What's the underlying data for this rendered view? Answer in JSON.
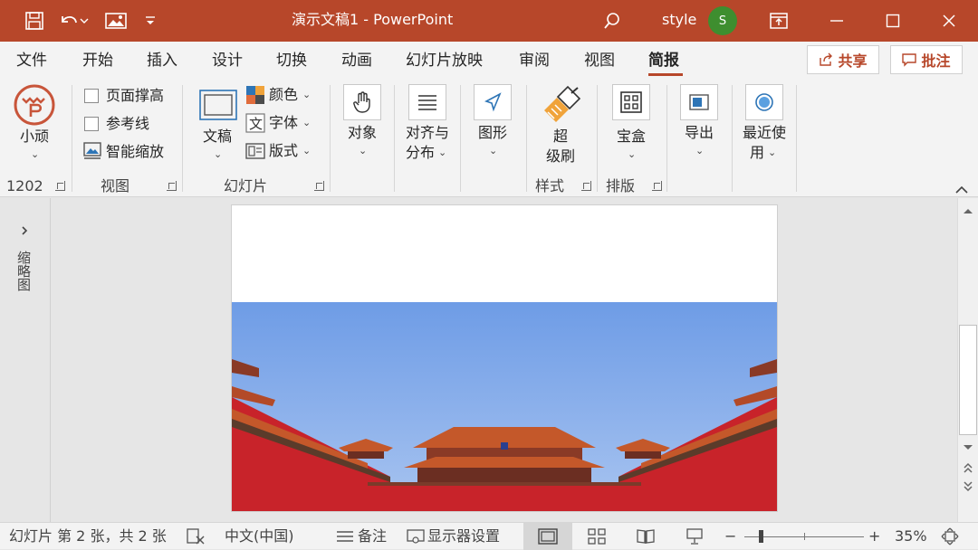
{
  "titlebar": {
    "document_title": "演示文稿1  -  PowerPoint",
    "username": "style",
    "avatar_initial": "S"
  },
  "menu": {
    "items": [
      "文件",
      "开始",
      "插入",
      "设计",
      "切换",
      "动画",
      "幻灯片放映",
      "审阅",
      "视图",
      "简报"
    ],
    "active": "简报",
    "share_label": "共享",
    "comment_label": "批注"
  },
  "ribbon": {
    "xiaoshuo": {
      "label": "小顽",
      "version": "1202"
    },
    "view_group": {
      "checkboxes": [
        {
          "label": "页面撑高",
          "checked": false
        },
        {
          "label": "参考线",
          "checked": false
        }
      ],
      "smart_zoom": "智能缩放",
      "group_label": "视图"
    },
    "slide_group": {
      "text_box": "文稿",
      "color": "颜色",
      "font": "字体",
      "layout": "版式",
      "group_label": "幻灯片"
    },
    "object": "对象",
    "align": {
      "line1": "对齐与",
      "line2": "分布"
    },
    "shape": "图形",
    "format_painter": {
      "line1": "超",
      "line2": "级刷"
    },
    "style_group_label": "样式",
    "toolbox": "宝盒",
    "layout_group_label": "排版",
    "export": "导出",
    "recent": {
      "line1": "最近使",
      "line2": "用"
    }
  },
  "left_panel": {
    "label": "缩略图"
  },
  "slide": {
    "sky_top": "#6e9ce6",
    "sky_bottom": "#a8c4f0",
    "wall_color": "#c8232a",
    "roof_color": "#c4582a"
  },
  "statusbar": {
    "slide_info": "幻灯片 第 2 张，共 2 张",
    "language": "中文(中国)",
    "notes": "备注",
    "display_settings": "显示器设置",
    "zoom_minus": "−",
    "zoom_plus": "+",
    "zoom_level": "35%",
    "zoom_fraction": 0.35
  },
  "colors": {
    "accent": "#b7472a"
  }
}
